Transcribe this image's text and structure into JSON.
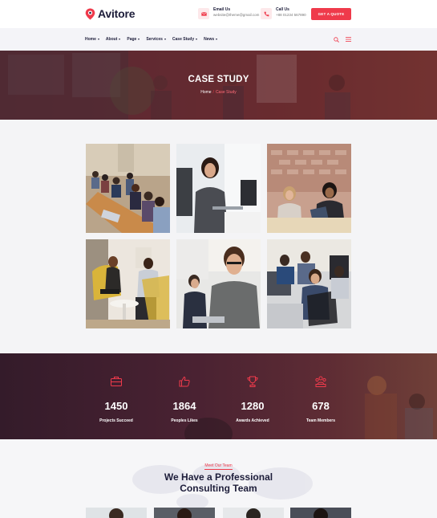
{
  "brand": {
    "name": "Avitore",
    "accent": "#ef3a4b",
    "dark": "#1d1d3a"
  },
  "header": {
    "email": {
      "label": "Email Us",
      "value": "website@theme@gmail.com",
      "icon": "envelope-icon"
    },
    "call": {
      "label": "Call Us",
      "value": "+88 01234 567890",
      "icon": "phone-icon"
    },
    "cta": "GET A QUOTE"
  },
  "nav": {
    "items": [
      {
        "label": "Home"
      },
      {
        "label": "About"
      },
      {
        "label": "Page"
      },
      {
        "label": "Services"
      },
      {
        "label": "Case Study"
      },
      {
        "label": "News"
      }
    ],
    "search_icon": "search-icon",
    "menu_icon": "hamburger-icon"
  },
  "hero": {
    "title": "CASE STUDY",
    "breadcrumb": {
      "home": "Home",
      "separator": "/",
      "current": "Case Study"
    }
  },
  "gallery": {
    "items": [
      {
        "name": "case-study-1"
      },
      {
        "name": "case-study-2"
      },
      {
        "name": "case-study-3"
      },
      {
        "name": "case-study-4"
      },
      {
        "name": "case-study-5"
      },
      {
        "name": "case-study-6"
      }
    ]
  },
  "stats": [
    {
      "value": "1450",
      "label": "Projects Succeed",
      "icon": "briefcase-icon"
    },
    {
      "value": "1864",
      "label": "Peoples Likes",
      "icon": "thumbs-up-icon"
    },
    {
      "value": "1280",
      "label": "Awards Achieved",
      "icon": "trophy-icon"
    },
    {
      "value": "678",
      "label": "Team Members",
      "icon": "team-icon"
    }
  ],
  "team": {
    "eyebrow": "Meet Our Team",
    "title_line1": "We Have a Professional",
    "title_line2": "Consulting Team"
  }
}
